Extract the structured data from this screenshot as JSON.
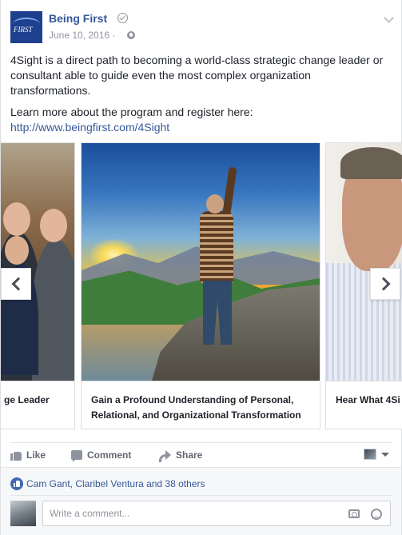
{
  "post": {
    "page_name": "Being First",
    "date": "June 10, 2016 ·",
    "logo_text": "FIRST",
    "paragraph1": "4Sight is a direct path to becoming a world-class strategic change leader or consultant able to guide even the most complex organization transformations.",
    "paragraph2": "Learn more about the program and register here:",
    "link": "http://www.beingfirst.com/4Sight"
  },
  "carousel": {
    "cards": [
      {
        "caption": "ge Leader"
      },
      {
        "caption": "Gain a Profound Understanding of Personal, Relational, and Organizational Transformation"
      },
      {
        "caption": "Hear What 4Si"
      }
    ]
  },
  "actions": {
    "like": "Like",
    "comment": "Comment",
    "share": "Share"
  },
  "reactions": {
    "names": "Cam Gant, Claribel Ventura and 38 others"
  },
  "comment_box": {
    "placeholder": "Write a comment..."
  },
  "colors": {
    "link": "#365899",
    "like_badge": "#4267b2",
    "muted": "#90949c"
  }
}
